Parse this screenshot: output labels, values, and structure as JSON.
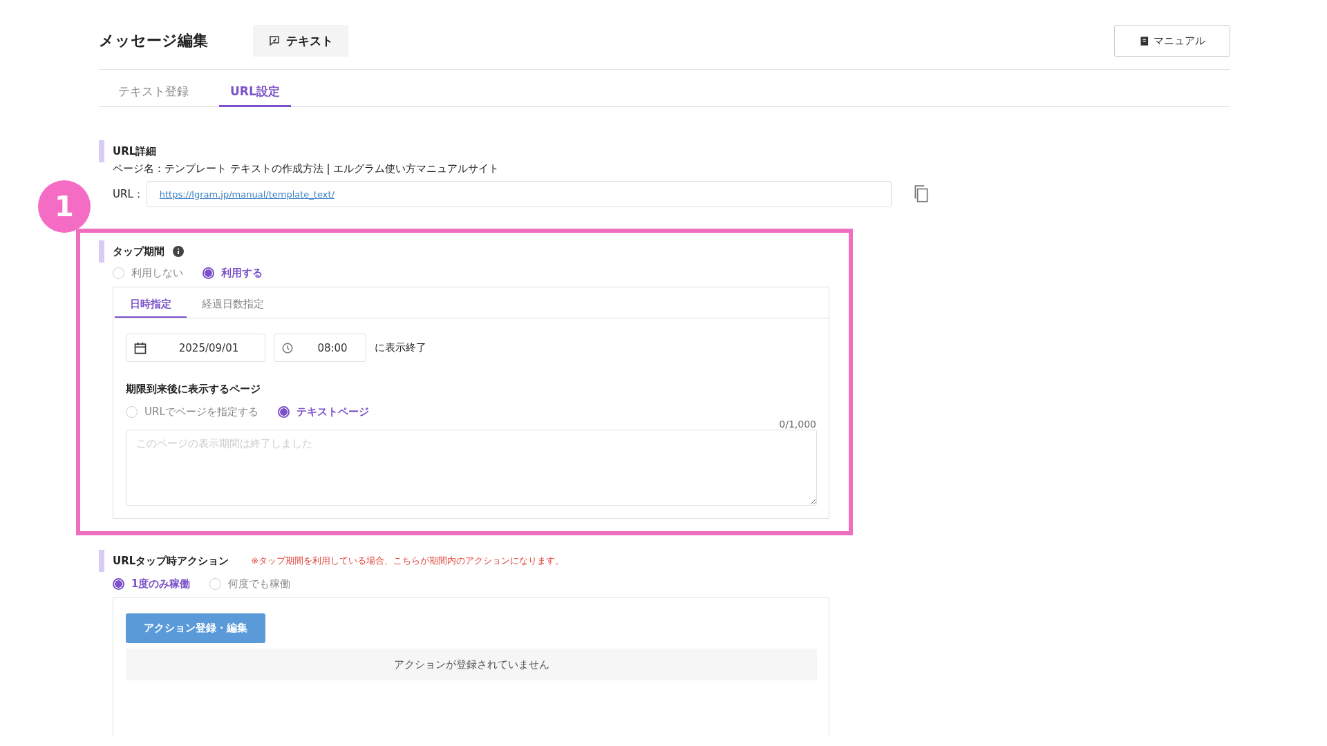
{
  "header": {
    "title": "メッセージ編集",
    "type_chip": "テキスト",
    "manual_button": "マニュアル"
  },
  "tabs": [
    {
      "label": "テキスト登録",
      "selected": false
    },
    {
      "label": "URL設定",
      "selected": true
    }
  ],
  "url_details": {
    "heading": "URL詳細",
    "page_name": "ページ名：テンプレート テキストの作成方法 | エルグラム使い方マニュアルサイト",
    "url_label": "URL：",
    "url": "https://lgram.jp/manual/template_text/"
  },
  "annotation": {
    "badge": "1"
  },
  "tap_period": {
    "heading": "タップ期間",
    "options": [
      {
        "label": "利用しない",
        "selected": false
      },
      {
        "label": "利用する",
        "selected": true
      }
    ],
    "tabs": [
      {
        "label": "日時指定",
        "selected": true
      },
      {
        "label": "経過日数指定",
        "selected": false
      }
    ],
    "date": "2025/09/01",
    "time": "08:00",
    "suffix": "に表示終了",
    "after_heading": "期限到来後に表示するページ",
    "after_options": [
      {
        "label": "URLでページを指定する",
        "selected": false
      },
      {
        "label": "テキストページ",
        "selected": true
      }
    ],
    "counter": "0/1,000",
    "placeholder": "このページの表示期間は終了しました"
  },
  "tap_action": {
    "heading": "URLタップ時アクション",
    "note": "※タップ期間を利用している場合、こちらが期間内のアクションになります。",
    "options": [
      {
        "label": "1度のみ稼働",
        "selected": true
      },
      {
        "label": "何度でも稼働",
        "selected": false
      }
    ],
    "button": "アクション登録・編集",
    "empty": "アクションが登録されていません"
  }
}
